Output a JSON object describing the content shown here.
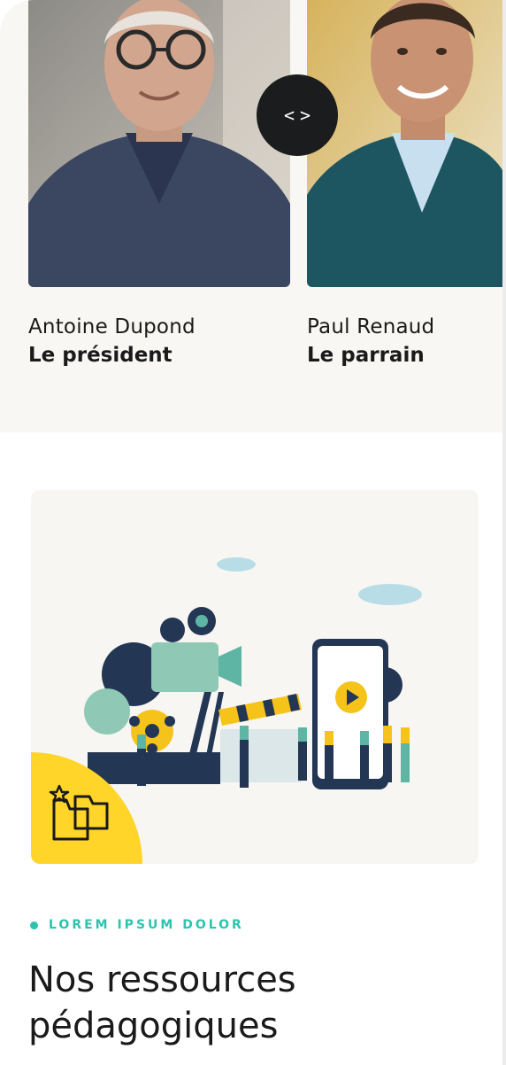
{
  "team": {
    "members": [
      {
        "name": "Antoine Dupond",
        "role": "Le président"
      },
      {
        "name": "Paul Renaud",
        "role": "Le parrain"
      }
    ],
    "toggle_icon": "code-brackets-icon",
    "toggle_left": "<",
    "toggle_right": ">"
  },
  "resources": {
    "eyebrow": "LOREM IPSUM DOLOR",
    "title": "Nos ressources pédagogiques",
    "badge_icon": "folders-star-icon"
  },
  "colors": {
    "accent": "#2cc4ae",
    "badge": "#ffd52a",
    "dark": "#1b1c1d"
  }
}
